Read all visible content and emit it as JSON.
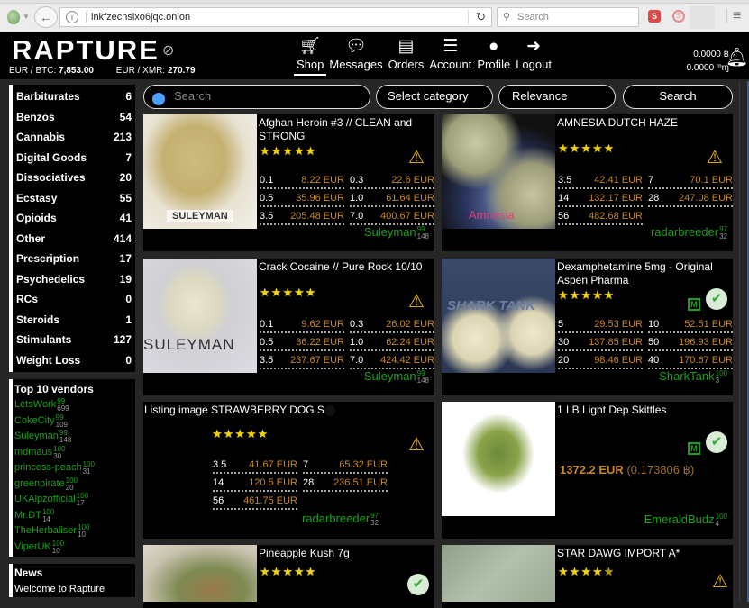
{
  "browser": {
    "url": "lnkfzecnslxo6jqc.onion",
    "search_placeholder": "Search",
    "back_icon": "←",
    "reload_icon": "↻",
    "menu_icon": "≡"
  },
  "header": {
    "logo": "RAPTURE",
    "rate_btc_label": "EUR / BTC:",
    "rate_btc_value": "7,853.00",
    "rate_xmr_label": "EUR / XMR:",
    "rate_xmr_value": "270.79",
    "nav": [
      {
        "label": "Shop",
        "icon": "🛒"
      },
      {
        "label": "Messages",
        "icon": "💬"
      },
      {
        "label": "Orders",
        "icon": "▤"
      },
      {
        "label": "Account",
        "icon": "☰"
      },
      {
        "label": "Profile",
        "icon": "👤"
      },
      {
        "label": "Logout",
        "icon": "➜"
      }
    ],
    "active_nav": "Shop",
    "balance_btc": "0.0000 ฿",
    "balance_xmr": "0.0000 ᵐɱ"
  },
  "categories": [
    {
      "name": "Barbiturates",
      "count": "6"
    },
    {
      "name": "Benzos",
      "count": "54"
    },
    {
      "name": "Cannabis",
      "count": "213"
    },
    {
      "name": "Digital Goods",
      "count": "7"
    },
    {
      "name": "Dissociatives",
      "count": "20"
    },
    {
      "name": "Ecstasy",
      "count": "55"
    },
    {
      "name": "Opioids",
      "count": "41"
    },
    {
      "name": "Other",
      "count": "414"
    },
    {
      "name": "Prescription",
      "count": "17"
    },
    {
      "name": "Psychedelics",
      "count": "19"
    },
    {
      "name": "RCs",
      "count": "0"
    },
    {
      "name": "Steroids",
      "count": "1"
    },
    {
      "name": "Stimulants",
      "count": "127"
    },
    {
      "name": "Weight Loss",
      "count": "0"
    }
  ],
  "top_vendors": {
    "title": "Top 10 vendors",
    "items": [
      {
        "name": "LetsWork",
        "score": "99",
        "count": "699"
      },
      {
        "name": "CokeCity",
        "score": "99",
        "count": "109"
      },
      {
        "name": "Suleyman",
        "score": "99",
        "count": "148"
      },
      {
        "name": "mdmaus",
        "score": "100",
        "count": "30"
      },
      {
        "name": "princess-peach",
        "score": "100",
        "count": "31"
      },
      {
        "name": "greenpirate",
        "score": "100",
        "count": "20"
      },
      {
        "name": "UKAlpzofficial",
        "score": "100",
        "count": "17"
      },
      {
        "name": "Mr.DT",
        "score": "100",
        "count": "14"
      },
      {
        "name": "TheHerbaliser",
        "score": "100",
        "count": "10"
      },
      {
        "name": "ViperUK",
        "score": "100",
        "count": "10"
      }
    ]
  },
  "news": {
    "title": "News",
    "items": [
      "Welcome to Rapture"
    ]
  },
  "filters": {
    "search_placeholder": "Search",
    "category": "Select category",
    "sort": "Relevance",
    "search_button": "Search"
  },
  "listings": [
    {
      "title": "Afghan Heroin #3 // CLEAN and STRONG",
      "rating": 5,
      "status": "warning",
      "image_label": "SULEYMAN",
      "prices": [
        [
          "0.1",
          "8.22 EUR"
        ],
        [
          "0.3",
          "22.6 EUR"
        ],
        [
          "0.5",
          "35.96 EUR"
        ],
        [
          "1.0",
          "61.64 EUR"
        ],
        [
          "3.5",
          "205.48 EUR"
        ],
        [
          "7.0",
          "400.67 EUR"
        ]
      ],
      "vendor": "Suleyman",
      "vendor_score": "99",
      "vendor_count": "148"
    },
    {
      "title": "AMNESIA DUTCH HAZE",
      "rating": 5,
      "status": "warning",
      "image_label": "Amnesia",
      "prices": [
        [
          "3.5",
          "42.41 EUR"
        ],
        [
          "7",
          "70.1 EUR"
        ],
        [
          "14",
          "132.17 EUR"
        ],
        [
          "28",
          "247.08 EUR"
        ],
        [
          "56",
          "482.68 EUR"
        ]
      ],
      "vendor": "radarbreeder",
      "vendor_score": "97",
      "vendor_count": "32"
    },
    {
      "title": "Crack Cocaine // Pure Rock 10/10",
      "rating": 5,
      "status": "warning",
      "image_label": "SULEYMAN",
      "prices": [
        [
          "0.1",
          "9.62 EUR"
        ],
        [
          "0.3",
          "26.02 EUR"
        ],
        [
          "0.5",
          "36.22 EUR"
        ],
        [
          "1.0",
          "62.24 EUR"
        ],
        [
          "3.5",
          "237.67 EUR"
        ],
        [
          "7.0",
          "424.42 EUR"
        ]
      ],
      "vendor": "Suleyman",
      "vendor_score": "99",
      "vendor_count": "148"
    },
    {
      "title": "Dexamphetamine 5mg - Original Aspen Pharma",
      "rating": 5,
      "status": "verified",
      "badge": "M",
      "image_label": "SHARK TANK",
      "prices": [
        [
          "5",
          "29.53 EUR"
        ],
        [
          "10",
          "52.51 EUR"
        ],
        [
          "30",
          "137.85 EUR"
        ],
        [
          "50",
          "196.93 EUR"
        ],
        [
          "20",
          "98.46 EUR"
        ],
        [
          "40",
          "170.67 EUR"
        ]
      ],
      "vendor": "SharkTank",
      "vendor_score": "100",
      "vendor_count": "3"
    },
    {
      "title": "STRAWBERRY DOG S",
      "image_alt": "Listing image",
      "rating": 5,
      "status": "warning",
      "prices": [
        [
          "3.5",
          "41.67 EUR"
        ],
        [
          "7",
          "65.32 EUR"
        ],
        [
          "14",
          "120.5 EUR"
        ],
        [
          "28",
          "236.51 EUR"
        ],
        [
          "56",
          "461.75 EUR"
        ]
      ],
      "vendor": "radarbreeder",
      "vendor_score": "97",
      "vendor_count": "32"
    },
    {
      "title": "1 LB Light Dep Skittles",
      "status": "verified",
      "badge": "M",
      "price_eur": "1372.2 EUR",
      "price_btc": "(0.173806 ฿)",
      "vendor": "EmeraldBudz",
      "vendor_score": "100",
      "vendor_count": "4"
    },
    {
      "title": "Pineapple Kush 7g",
      "rating": 5,
      "status": "verified"
    },
    {
      "title": "STAR DAWG IMPORT A*",
      "rating": 4.5,
      "status": "warning"
    }
  ],
  "icons": {
    "star": "★",
    "warning": "⚠",
    "check": "✔",
    "bell": "🔔"
  }
}
